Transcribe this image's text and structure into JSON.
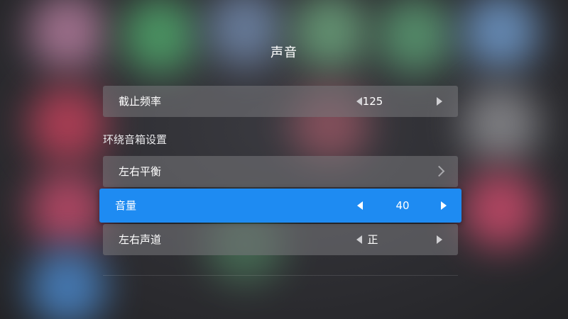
{
  "screen": {
    "title": "声音"
  },
  "settings": {
    "cutoff": {
      "label": "截止频率",
      "value": "125"
    },
    "surround_section_label": "环绕音箱设置",
    "balance": {
      "label": "左右平衡"
    },
    "volume": {
      "label": "音量",
      "value": "40"
    },
    "channel": {
      "label": "左右声道",
      "value": "正"
    }
  },
  "colors": {
    "focus_accent": "#1e8bf2"
  }
}
